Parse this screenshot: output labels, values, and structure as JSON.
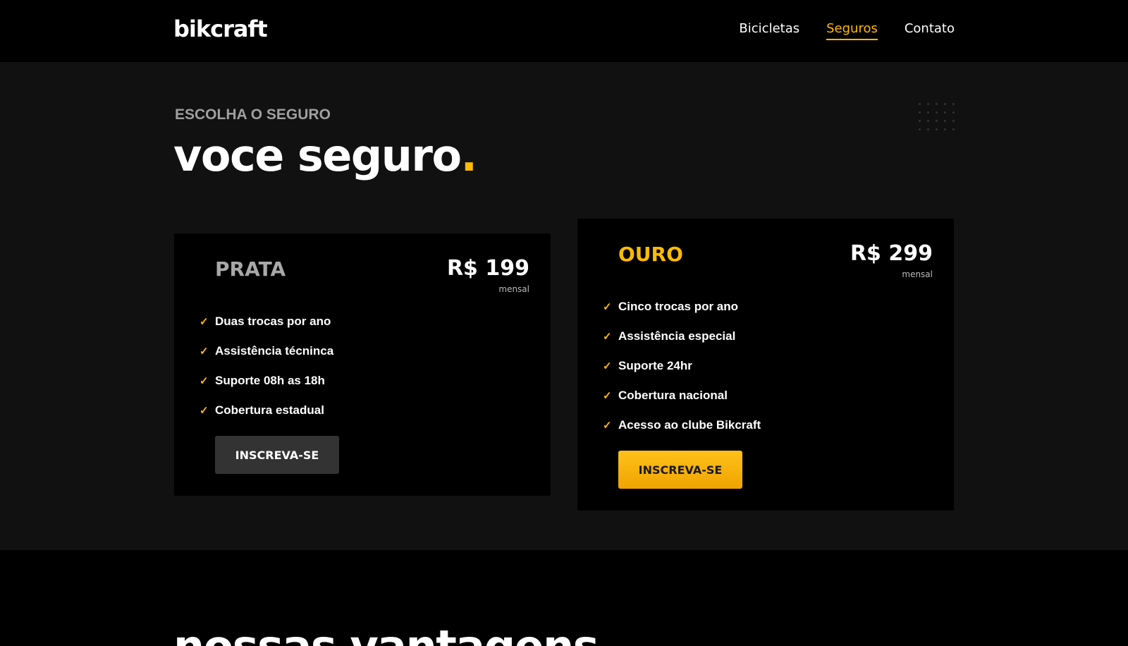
{
  "brand": {
    "logo": "bikcraft"
  },
  "nav": {
    "items": [
      {
        "label": "Bicicletas",
        "active": false
      },
      {
        "label": "Seguros",
        "active": true
      },
      {
        "label": "Contato",
        "active": false
      }
    ]
  },
  "hero": {
    "eyebrow": "ESCOLHA O SEGURO",
    "title": "voce seguro",
    "title_dot": "."
  },
  "plans": {
    "silver": {
      "name": "PRATA",
      "price": "R$ 199",
      "period": "mensal",
      "features": [
        "Duas trocas por ano",
        "Assistência técninca",
        "Suporte 08h as 18h",
        "Cobertura estadual"
      ],
      "cta": "INSCREVA-SE"
    },
    "gold": {
      "name": "OURO",
      "price": "R$ 299",
      "period": "mensal",
      "features": [
        "Cinco trocas por ano",
        "Assistência especial",
        "Suporte 24hr",
        "Cobertura nacional",
        "Acesso ao clube Bikcraft"
      ],
      "cta": "INSCREVA-SE"
    }
  },
  "next_section": {
    "title": "nossas vantagens"
  },
  "colors": {
    "accent": "#ffbb00",
    "background": "#111111",
    "card": "#000000"
  },
  "icons": {
    "feature_bullet": "check-icon",
    "decoration": "dot-grid-icon"
  }
}
